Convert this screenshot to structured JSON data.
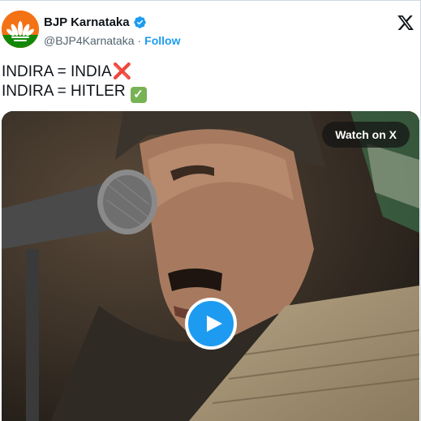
{
  "account": {
    "display_name": "BJP Karnataka",
    "handle": "@BJP4Karnataka",
    "separator": "·",
    "follow_label": "Follow",
    "verified": true
  },
  "tweet": {
    "line1_text": "INDIRA = INDIA",
    "line1_emoji": "cross-mark",
    "line2_text": "INDIRA = HITLER",
    "line2_emoji": "check-mark-button"
  },
  "media": {
    "watch_label": "Watch on X",
    "play_icon": "play-icon"
  },
  "icons": {
    "brand": "x-logo-icon",
    "avatar": "bjp-lotus-logo",
    "verified": "verified-badge-icon"
  },
  "colors": {
    "accent_blue": "#1d9bf0",
    "text_primary": "#0f1419",
    "text_secondary": "#536471",
    "avatar_orange": "#f47216",
    "cross_red": "#e0243a",
    "check_green": "#77b255"
  }
}
